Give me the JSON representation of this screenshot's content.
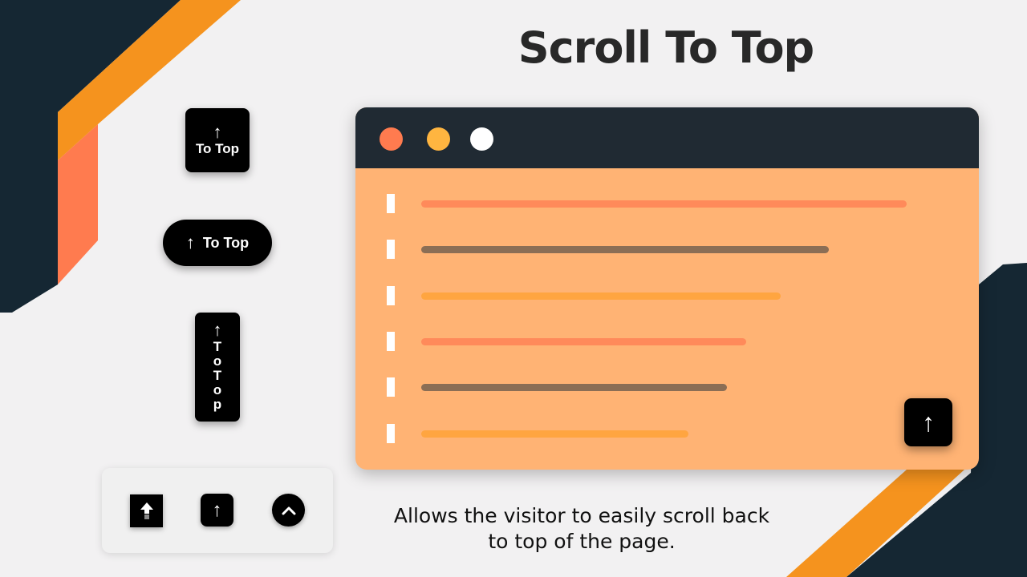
{
  "title": "Scroll To Top",
  "description": "Allows the visitor to easily scroll back to top of the page.",
  "colors": {
    "navy": "#152733",
    "orange": "#f5931e",
    "coral": "#ff7b4f",
    "background": "#f2f1f2",
    "browser_bar": "#202a33",
    "browser_body": "#ffb374",
    "dot_red": "#ff7b4f",
    "dot_yellow": "#ffb540",
    "dot_white": "#ffffff",
    "line_coral": "#ff8a5a",
    "line_brown": "#8b6e55",
    "line_orange": "#ffa540"
  },
  "buttons": [
    {
      "style": "square",
      "icon": "arrow-up-icon",
      "arrow": "↑",
      "label": "To Top"
    },
    {
      "style": "pill",
      "icon": "arrow-up-icon",
      "arrow": "↑",
      "label": "To Top"
    },
    {
      "style": "vertical",
      "icon": "arrow-up-icon",
      "arrow": "↑",
      "label": "T\no\nT\no\np"
    }
  ],
  "icon_panel": [
    {
      "icon": "bold-arrow-up-icon"
    },
    {
      "icon": "arrow-up-icon",
      "glyph": "↑"
    },
    {
      "icon": "chevron-up-icon"
    }
  ],
  "browser": {
    "dots": [
      "close",
      "minimize",
      "maximize"
    ],
    "lines": [
      {
        "color": "coral",
        "length": 1.0
      },
      {
        "color": "brown",
        "length": 0.84
      },
      {
        "color": "orange",
        "length": 0.74
      },
      {
        "color": "coral",
        "length": 0.67
      },
      {
        "color": "brown",
        "length": 0.63
      },
      {
        "color": "orange",
        "length": 0.55
      }
    ],
    "scroll_button": {
      "icon": "arrow-up-icon",
      "glyph": "↑"
    }
  }
}
